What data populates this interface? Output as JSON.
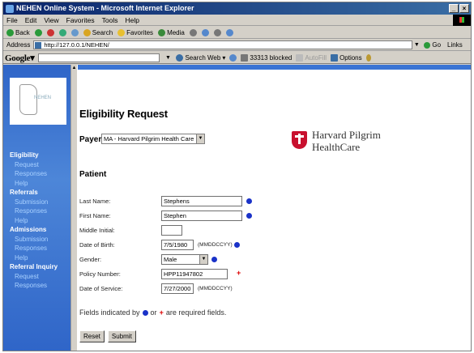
{
  "window": {
    "title": "NEHEN Online System - Microsoft Internet Explorer",
    "controls": [
      "_",
      "×"
    ]
  },
  "menu": [
    "File",
    "Edit",
    "View",
    "Favorites",
    "Tools",
    "Help"
  ],
  "toolbar": {
    "back": "Back",
    "search": "Search",
    "favorites": "Favorites",
    "media": "Media"
  },
  "address": {
    "label": "Address",
    "url": "http://127.0.0.1/NEHEN/",
    "go": "Go",
    "links": "Links"
  },
  "googlebar": {
    "logo": "Google",
    "search_web": "Search Web",
    "blocked": "33313 blocked",
    "autofill": "AutoFill",
    "options": "Options"
  },
  "sidebar": {
    "logo_text": "NEHEN",
    "items": [
      {
        "label": "Eligibility",
        "head": true
      },
      {
        "label": "Request",
        "head": false
      },
      {
        "label": "Responses",
        "head": false
      },
      {
        "label": "Help",
        "head": false
      },
      {
        "label": "Referrals",
        "head": true
      },
      {
        "label": "Submission",
        "head": false
      },
      {
        "label": "Responses",
        "head": false
      },
      {
        "label": "Help",
        "head": false
      },
      {
        "label": "Admissions",
        "head": true
      },
      {
        "label": "Submission",
        "head": false
      },
      {
        "label": "Responses",
        "head": false
      },
      {
        "label": "Help",
        "head": false
      },
      {
        "label": "Referral Inquiry",
        "head": true
      },
      {
        "label": "Request",
        "head": false
      },
      {
        "label": "Responses",
        "head": false
      }
    ]
  },
  "page": {
    "title": "Eligibility Request",
    "payer_label": "Payer:",
    "payer_value": "MA - Harvard Pilgrim Health Care",
    "brand_line1": "Harvard Pilgrim",
    "brand_line2": "HealthCare",
    "section": "Patient"
  },
  "form": {
    "last_name": {
      "label": "Last Name:",
      "value": "Stephens"
    },
    "first_name": {
      "label": "First Name:",
      "value": "Stephen"
    },
    "middle_initial": {
      "label": "Middle Initial:",
      "value": ""
    },
    "dob": {
      "label": "Date of Birth:",
      "value": "7/5/1980",
      "hint": "(MMDDCCYY)"
    },
    "gender": {
      "label": "Gender:",
      "value": "Male"
    },
    "policy": {
      "label": "Policy Number:",
      "value": "HPP11947802"
    },
    "dos": {
      "label": "Date of Service:",
      "value": "7/27/2000",
      "hint": "(MMDDCCYY)"
    }
  },
  "required_note": {
    "prefix": "Fields indicated by",
    "middle": "or",
    "suffix": "are required fields."
  },
  "buttons": {
    "reset": "Reset",
    "submit": "Submit"
  },
  "colors": {
    "nav_blue": "#2f65c8",
    "required_dot": "#1a32c8",
    "required_plus": "#dd0000",
    "brand_red": "#c8102e"
  }
}
